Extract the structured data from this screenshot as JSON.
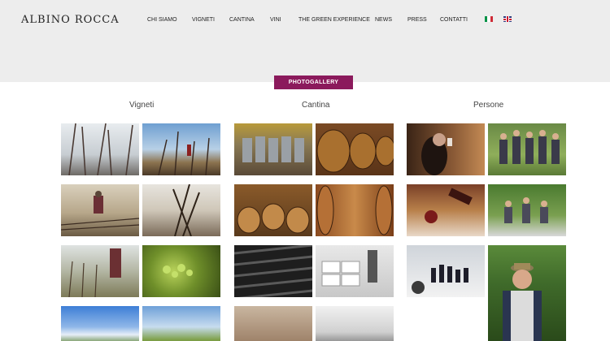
{
  "header": {
    "logo": "ALBINO ROCCA",
    "nav": [
      "CHI SIAMO",
      "VIGNETI",
      "CANTINA",
      "VINI",
      "THE GREEN EXPERIENCE",
      "NEWS",
      "PRESS",
      "CONTATTI"
    ]
  },
  "languages": [
    "italian-flag-icon",
    "english-flag-icon"
  ],
  "gallery": {
    "badge": "PHOTOGALLERY",
    "columns": [
      {
        "title": "Vigneti",
        "photos": [
          "frosted vine branches",
          "vineyard in winter with worker",
          "worker tying vines",
          "winter vines and hills",
          "workers in vineyard rows",
          "green vine leaves close-up",
          "blue sky over vineyard",
          "green vineyard landscape"
        ]
      },
      {
        "title": "Cantina",
        "photos": [
          "stainless steel vats",
          "large wooden barrels",
          "barrels in cellar",
          "barrel room corridor",
          "stacked bottles",
          "boxes in warehouse",
          "winery interior",
          "tasting table"
        ]
      },
      {
        "title": "Persone",
        "photos": [
          "winemaker tasting glass",
          "family group outdoors",
          "pouring wine",
          "family seated outdoors",
          "wine tasting with bottles",
          "man in hat portrait"
        ]
      }
    ]
  },
  "colors": {
    "accent": "#8b1a5c",
    "header_bg": "#ededed"
  }
}
